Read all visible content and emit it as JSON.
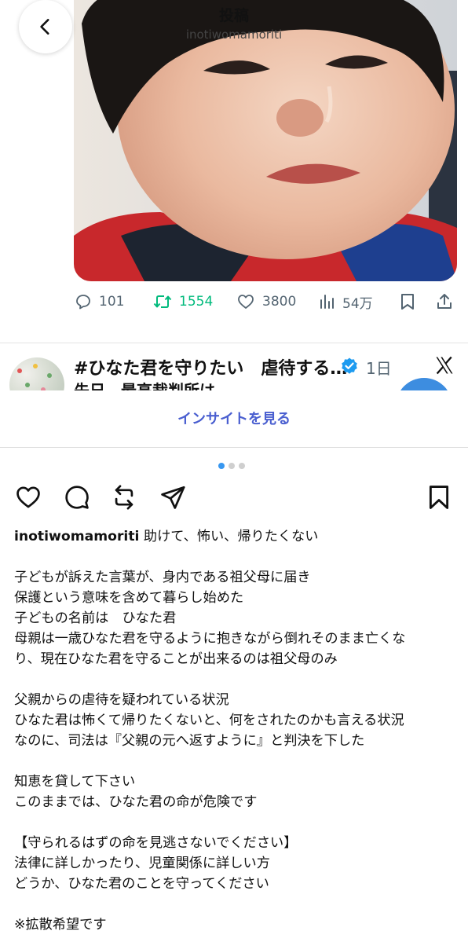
{
  "header": {
    "title": "投稿",
    "username": "inotiwomamoriti"
  },
  "tweet_actions": {
    "replies": "101",
    "retweets": "1554",
    "likes": "3800",
    "views": "54万",
    "retweet_color": "#00ba7c"
  },
  "next_tweet": {
    "title": "#ひなた君を守りたい　虐待する…",
    "time": "1日",
    "body_preview": "先日、最高裁判所は",
    "verified_color": "#1d9bf0"
  },
  "insights": {
    "label": "インサイトを見る",
    "color": "#4a5fd0"
  },
  "carousel": {
    "total": 3,
    "active": 1
  },
  "post": {
    "username": "inotiwomamoriti",
    "caption_first": "助けて、怖い、帰りたくない",
    "lines": [
      "子どもが訴えた言葉が、身内である祖父母に届き",
      "保護という意味を含めて暮らし始めた",
      "子どもの名前は　ひなた君",
      "母親は一歳ひなた君を守るように抱きながら倒れそのまま亡くな",
      "り、現在ひなた君を守ることが出来るのは祖父母のみ",
      "父親からの虐待を疑われている状況",
      "ひなた君は怖くて帰りたくないと、何をされたのかも言える状況",
      "なのに、司法は『父親の元へ返すように』と判決を下した",
      "知恵を貸して下さい",
      "このままでは、ひなた君の命が危険です",
      "【守られるはずの命を見逃さないでください】",
      "法律に詳しかったり、児童関係に詳しい方",
      "どうか、ひなた君のことを守ってください",
      "※拡散希望です"
    ]
  },
  "icons": {
    "back": "chevron-left-icon",
    "reply": "speech-bubble-icon",
    "retweet": "retweet-arrows-icon",
    "like": "heart-icon",
    "views": "bar-chart-icon",
    "bookmark": "bookmark-icon",
    "share": "share-upload-icon",
    "verified": "verified-badge-icon",
    "x_logo": "x-logo-icon",
    "ig_like": "heart-icon",
    "ig_comment": "comment-bubble-icon",
    "ig_repost": "repost-arrows-icon",
    "ig_send": "paper-plane-icon",
    "ig_save": "bookmark-icon"
  }
}
